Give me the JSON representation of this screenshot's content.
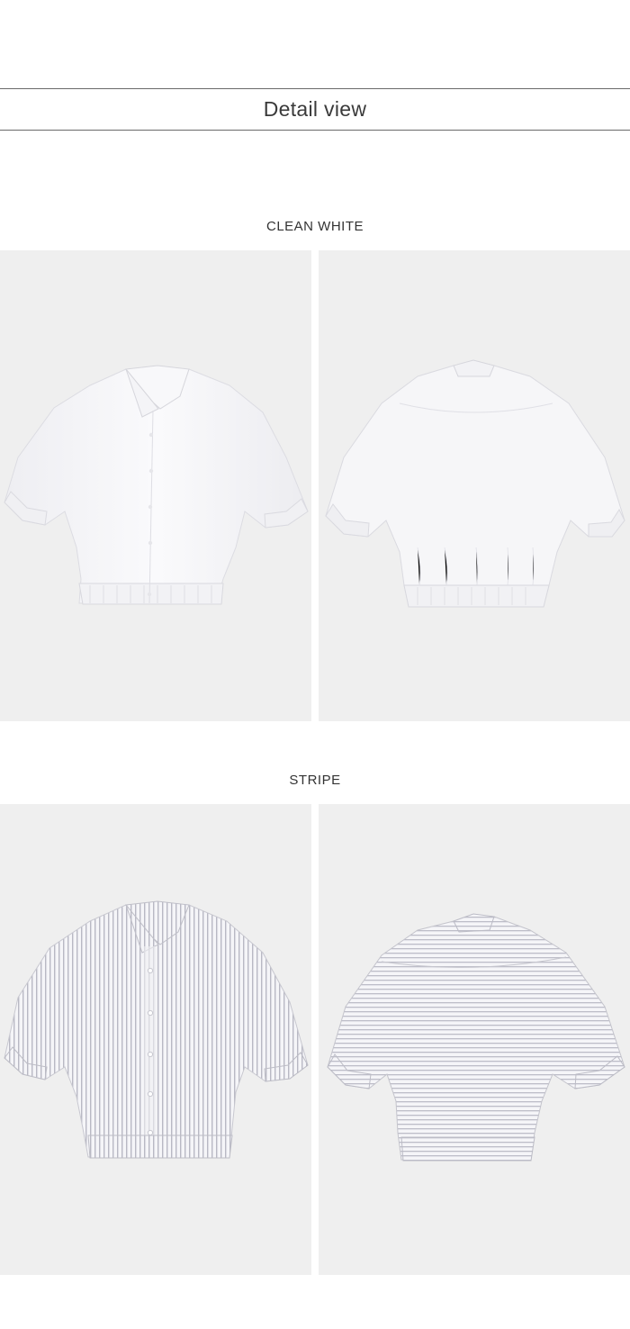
{
  "header": {
    "title": "Detail view"
  },
  "sections": [
    {
      "title": "CLEAN WHITE",
      "images": [
        {
          "label": "front",
          "icon": "shirt-front-white"
        },
        {
          "label": "back",
          "icon": "shirt-back-white"
        }
      ]
    },
    {
      "title": "STRIPE",
      "images": [
        {
          "label": "front",
          "icon": "shirt-front-stripe"
        },
        {
          "label": "back",
          "icon": "shirt-back-stripe"
        }
      ]
    }
  ],
  "colors": {
    "photo_bg": "#efefef",
    "white_shirt": "#f7f7f9",
    "stripe_line": "#b9b9c4",
    "rule": "#6a6a6a"
  }
}
